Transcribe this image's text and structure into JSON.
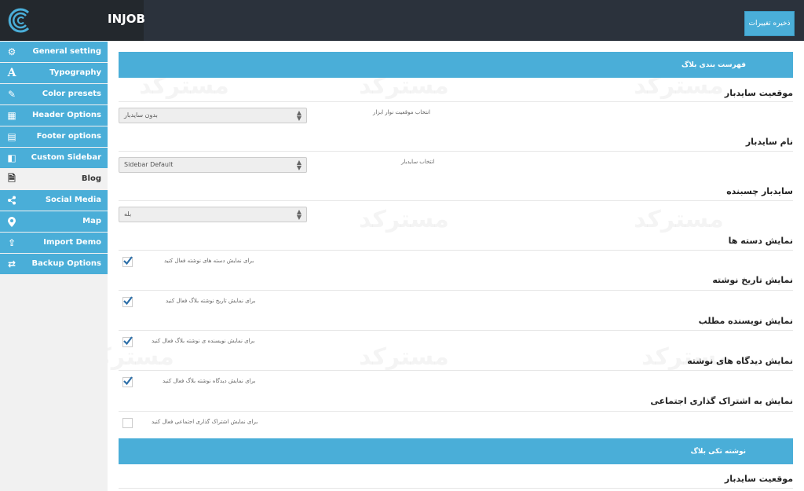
{
  "topbar": {
    "brand": "INJOB",
    "save_label": "ذخیره تغییرات"
  },
  "sidebar": {
    "items": [
      {
        "label": "General setting",
        "icon": "gear-icon"
      },
      {
        "label": "Typography",
        "icon": "font-icon"
      },
      {
        "label": "Color presets",
        "icon": "brush-icon"
      },
      {
        "label": "Header Options",
        "icon": "header-icon"
      },
      {
        "label": "Footer options",
        "icon": "footer-icon"
      },
      {
        "label": "Custom Sidebar",
        "icon": "sidebar-icon"
      },
      {
        "label": "Blog",
        "icon": "document-icon",
        "active": true
      },
      {
        "label": "Social Media",
        "icon": "share-icon"
      },
      {
        "label": "Map",
        "icon": "map-pin-icon"
      },
      {
        "label": "Import Demo",
        "icon": "upload-icon"
      },
      {
        "label": "Backup Options",
        "icon": "swap-icon"
      }
    ]
  },
  "main": {
    "section1_title": "فهرست بندی بلاگ",
    "sidebar_position": {
      "title": "موقعیت سایدبار",
      "desc": "انتخاب موقعیت نوار ابزار",
      "value": "بدون سایدبار"
    },
    "sidebar_name": {
      "title": "نام سایدبار",
      "desc": "انتخاب سایدبار",
      "value": "Sidebar Default"
    },
    "sticky_sidebar": {
      "title": "سایدبار چسبنده",
      "value": "بله"
    },
    "show_categories": {
      "title": "نمایش دسته ها",
      "desc": "برای نمایش دسته های نوشته فعال کنید",
      "checked": true
    },
    "show_date": {
      "title": "نمایش تاریخ نوشته",
      "desc": "برای نمایش تاریخ نوشته بلاگ فعال کنید",
      "checked": true
    },
    "show_author": {
      "title": "نمایش نویسنده مطلب",
      "desc": "برای نمایش نویسنده ی نوشته بلاگ فعال کنید",
      "checked": true
    },
    "show_comments": {
      "title": "نمایش دیدگاه های نوشته",
      "desc": "برای نمایش دیدگاه نوشته بلاگ فعال کنید",
      "checked": true
    },
    "show_share": {
      "title": "نمایش به اشتراک گذاری اجتماعی",
      "desc": "برای نمایش اشتراک گذاری اجتماعی فعال کنید",
      "checked": false
    },
    "section2_title": "نوشته تکی بلاگ",
    "single_sidebar_position": {
      "title": "موقعیت سایدبار"
    },
    "watermark": "مسترکد"
  },
  "colors": {
    "accent": "#4aaed8",
    "topbar": "#2b323c",
    "logo_bg": "#23282d"
  }
}
